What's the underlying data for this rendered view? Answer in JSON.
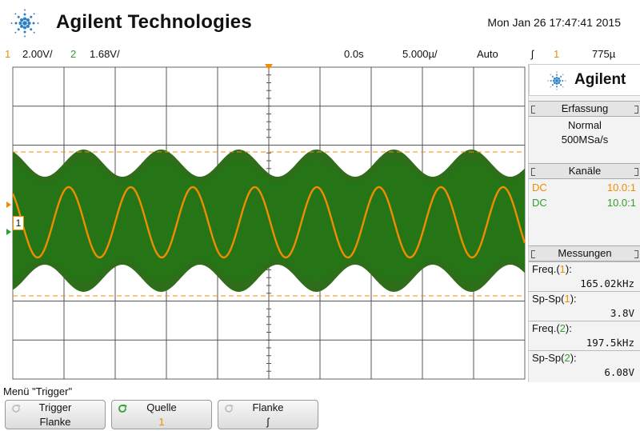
{
  "header": {
    "brand": "Agilent Technologies",
    "datetime": "Mon Jan 26 17:47:41 2015"
  },
  "status": {
    "ch1_num": "1",
    "ch1_scale": "2.00V/",
    "ch2_num": "2",
    "ch2_scale": "1.68V/",
    "time_offset": "0.0s",
    "time_scale": "5.000µ/",
    "trigger_mode": "Auto",
    "trigger_slope_symbol": "ʃ",
    "trigger_source": "1",
    "trigger_level": "775µ"
  },
  "screen": {
    "ch1_marker": "1",
    "ch1_signal": {
      "color": "#f08c00",
      "periods_on_screen": 8.25
    },
    "ch2_signal": {
      "color": "#2e6e1a",
      "envelope_periods_on_screen": 6.6
    }
  },
  "sidepanel": {
    "brand": "Agilent",
    "erfassung": {
      "title": "Erfassung",
      "mode": "Normal",
      "rate": "500MSa/s"
    },
    "kanaele": {
      "title": "Kanäle",
      "rows": [
        {
          "coupling": "DC",
          "probe": "10.0:1",
          "color": "#f08c00"
        },
        {
          "coupling": "DC",
          "probe": "10.0:1",
          "color": "#2ea02e"
        }
      ]
    },
    "messungen": {
      "title": "Messungen",
      "items": [
        {
          "label": "Freq.(",
          "ch": "1",
          "label_end": "):",
          "value": "165.02kHz",
          "ch_color": "#f08c00"
        },
        {
          "label": "Sp-Sp(",
          "ch": "1",
          "label_end": "):",
          "value": "3.8V",
          "ch_color": "#f08c00"
        },
        {
          "label": "Freq.(",
          "ch": "2",
          "label_end": "):",
          "value": "197.5kHz",
          "ch_color": "#2ea02e"
        },
        {
          "label": "Sp-Sp(",
          "ch": "2",
          "label_end": "):",
          "value": "6.08V",
          "ch_color": "#2ea02e"
        }
      ]
    }
  },
  "menu": {
    "title": "Menü \"Trigger\"",
    "softkeys": [
      {
        "top": "Trigger",
        "bottom": "Flanke",
        "bottom_color": "#111"
      },
      {
        "top": "Quelle",
        "bottom": "1",
        "bottom_color": "#f08c00"
      },
      {
        "top": "Flanke",
        "bottom": "ʃ",
        "bottom_color": "#111"
      }
    ]
  }
}
